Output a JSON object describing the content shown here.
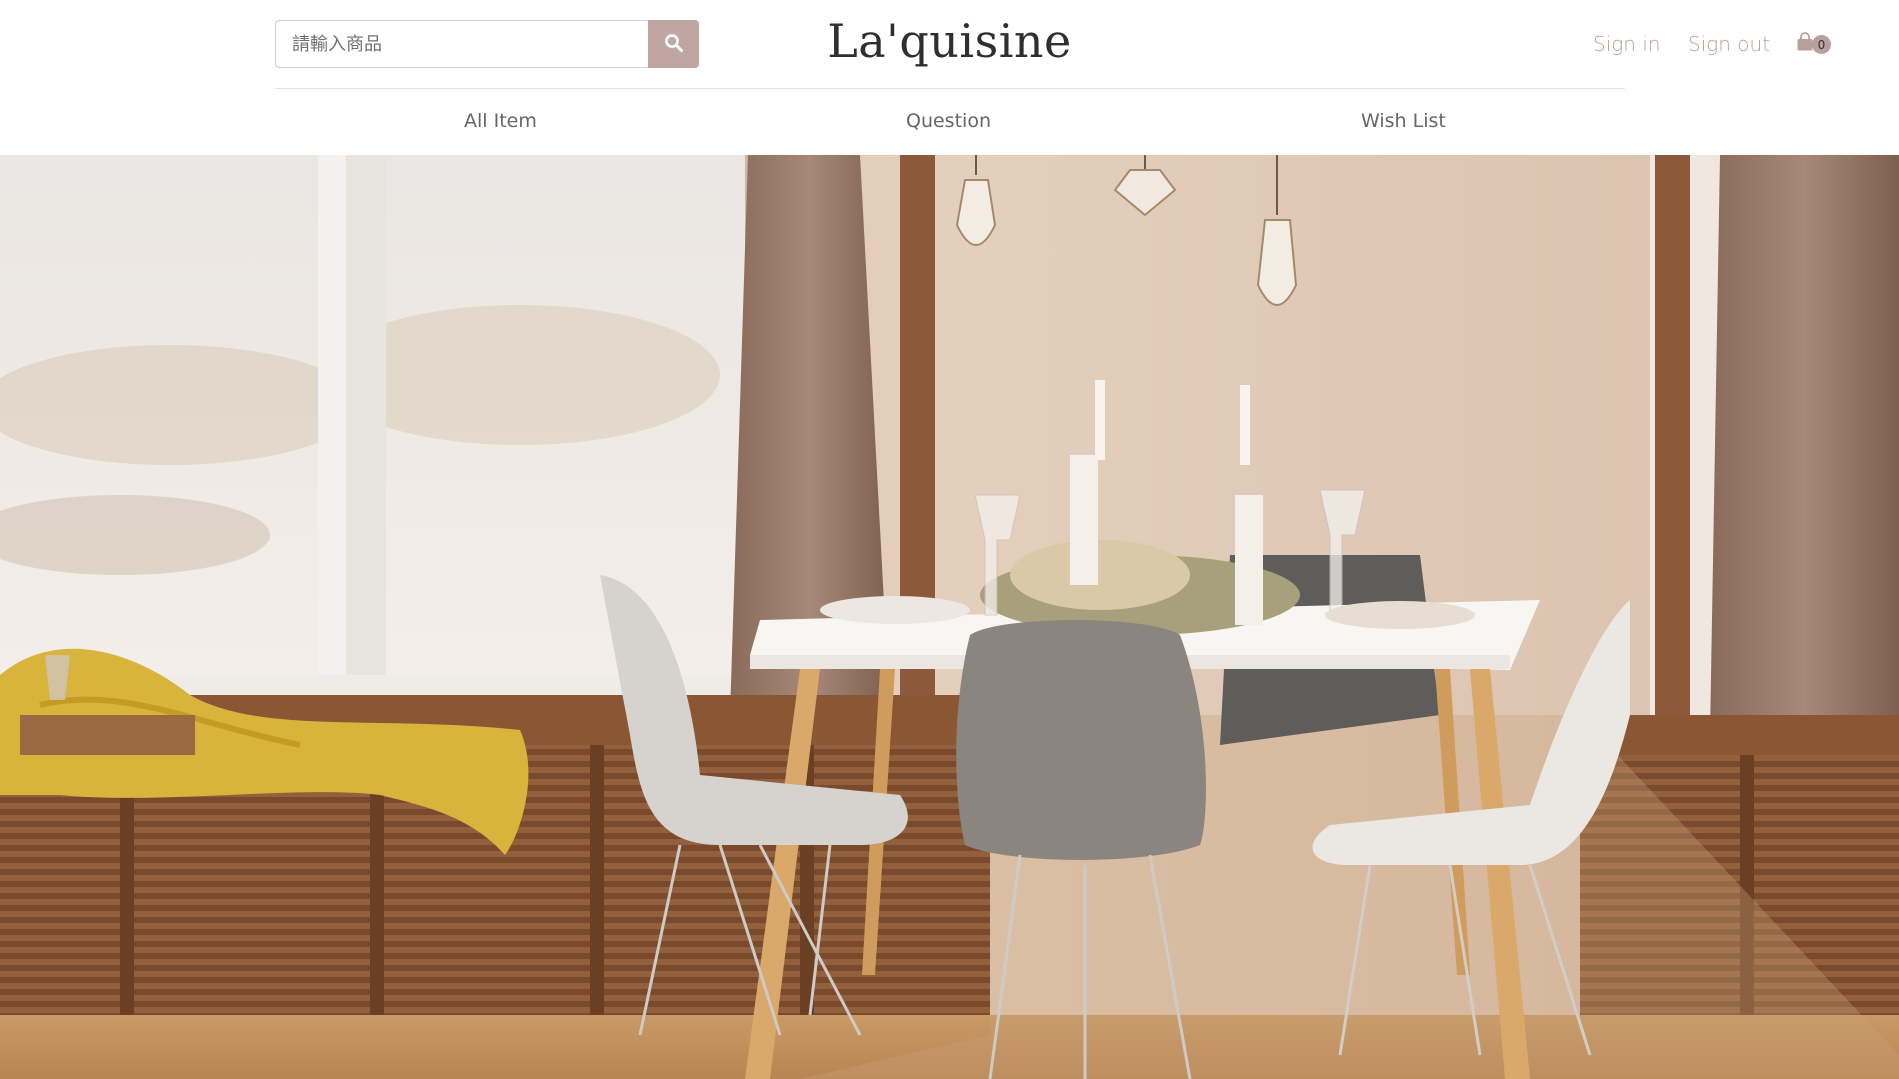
{
  "search": {
    "placeholder": "請輸入商品",
    "icon": "search-icon"
  },
  "brand": {
    "name": "La'quisine"
  },
  "account": {
    "sign_in": "Sign in",
    "sign_out": "Sign out"
  },
  "cart": {
    "icon": "shopping-bag-icon",
    "count": "0"
  },
  "menu": {
    "items": [
      {
        "label": "All Item"
      },
      {
        "label": "Question"
      },
      {
        "label": "Wish List"
      }
    ]
  },
  "colors": {
    "accent": "#bfa6a3",
    "link": "#b7a09d",
    "logo": "#2f2f2f"
  }
}
